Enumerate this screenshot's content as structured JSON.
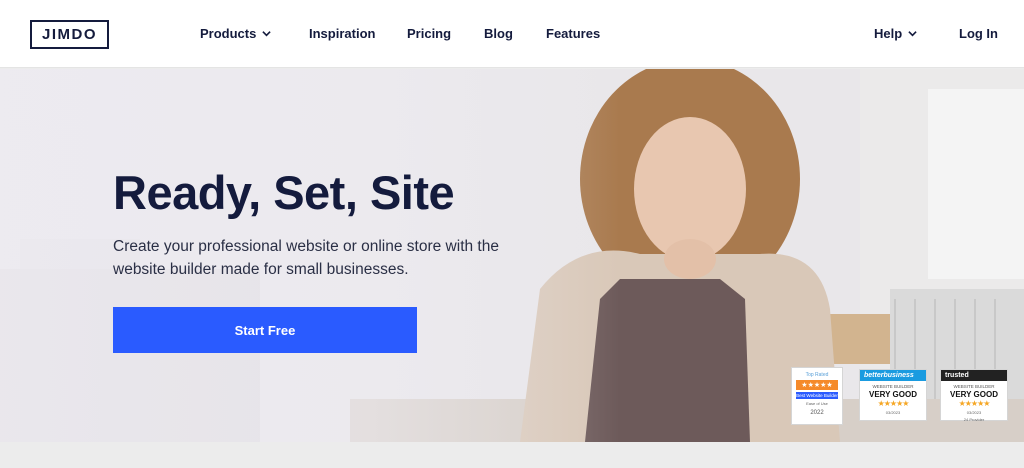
{
  "header": {
    "logo": "JIMDO",
    "nav": [
      {
        "label": "Products",
        "has_dropdown": true
      },
      {
        "label": "Inspiration",
        "has_dropdown": false
      },
      {
        "label": "Pricing",
        "has_dropdown": false
      },
      {
        "label": "Blog",
        "has_dropdown": false
      },
      {
        "label": "Features",
        "has_dropdown": false
      }
    ],
    "help": {
      "label": "Help",
      "has_dropdown": true
    },
    "login": "Log In"
  },
  "hero": {
    "title": "Ready, Set, Site",
    "subtitle": "Create your professional website or online store with the website builder made for small businesses.",
    "cta": "Start Free",
    "cta_color": "#2a5bff"
  },
  "badges": [
    {
      "source": "Top Rated",
      "stars": "★★★★★",
      "label": "Best Website Builder",
      "sublabel": "Ease of Use",
      "year": "2022"
    },
    {
      "source": "betterbusiness",
      "category": "WEBSITE BUILDER",
      "rating": "VERY GOOD",
      "stars": "★★★★★",
      "date": "03/2023"
    },
    {
      "source": "trusted",
      "category": "WEBSITE BUILDER",
      "rating": "VERY GOOD",
      "stars": "★★★★★",
      "date": "03/2023",
      "tested": "24 Provider"
    }
  ],
  "colors": {
    "navy": "#141b3d",
    "accent": "#2a5bff"
  }
}
